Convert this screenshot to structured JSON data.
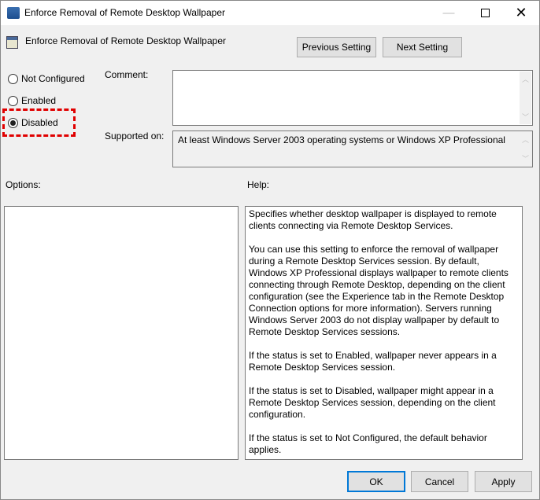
{
  "window": {
    "title": "Enforce Removal of Remote Desktop Wallpaper"
  },
  "header": {
    "policy_name": "Enforce Removal of Remote Desktop Wallpaper",
    "previous_label": "Previous Setting",
    "next_label": "Next Setting"
  },
  "state": {
    "options": [
      {
        "label": "Not Configured",
        "checked": false
      },
      {
        "label": "Enabled",
        "checked": false
      },
      {
        "label": "Disabled",
        "checked": true
      }
    ],
    "highlight_color": "#e00000"
  },
  "comment": {
    "label": "Comment:",
    "value": ""
  },
  "supported": {
    "label": "Supported on:",
    "value": "At least Windows Server 2003 operating systems or Windows XP Professional"
  },
  "options_label": "Options:",
  "help": {
    "label": "Help:",
    "paragraphs": [
      "Specifies whether desktop wallpaper is displayed to remote clients connecting via Remote Desktop Services.",
      "You can use this setting to enforce the removal of wallpaper during a Remote Desktop Services session. By default, Windows XP Professional displays wallpaper to remote clients connecting through Remote Desktop, depending on the client configuration (see the Experience tab in the Remote Desktop Connection options for more information). Servers running Windows Server 2003 do not display wallpaper by default to Remote Desktop Services sessions.",
      "If the status is set to Enabled, wallpaper never appears in a Remote Desktop Services session.",
      "If the status is set to Disabled, wallpaper might appear in a Remote Desktop Services session, depending on the client configuration.",
      "If the status is set to Not Configured, the default behavior applies."
    ]
  },
  "footer": {
    "ok": "OK",
    "cancel": "Cancel",
    "apply": "Apply"
  }
}
